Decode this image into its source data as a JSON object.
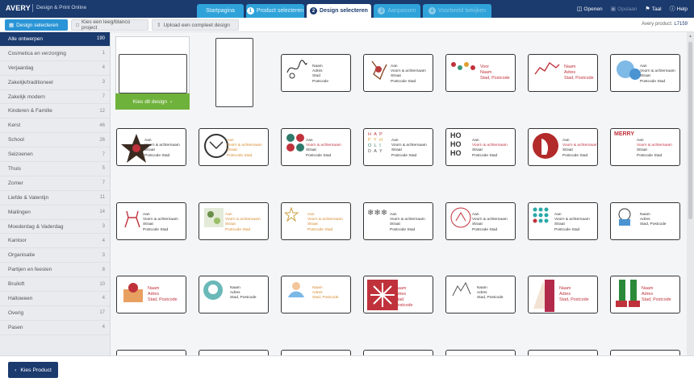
{
  "header": {
    "logo": "AVERY",
    "subtitle": "Design & Print Online",
    "steps": [
      {
        "num": "",
        "label": "Startpagina"
      },
      {
        "num": "1",
        "label": "Product selecteren"
      },
      {
        "num": "2",
        "label": "Design selecteren"
      },
      {
        "num": "3",
        "label": "Aanpassen"
      },
      {
        "num": "4",
        "label": "Voorbeeld bekijken"
      }
    ],
    "links": [
      "Openen",
      "Opslaan",
      "Taal",
      "Help"
    ]
  },
  "subbar": {
    "buttons": [
      "Design selecteren",
      "Kies een leeg/blanco project",
      "Upload een compleet design"
    ],
    "avery_product_label": "Avery product:",
    "avery_product_code": "L7159"
  },
  "sidebar": {
    "categories": [
      {
        "label": "Alle ontwerpen",
        "count": "190"
      },
      {
        "label": "Cosmetica en verzorging",
        "count": "1"
      },
      {
        "label": "Verjaardag",
        "count": "4"
      },
      {
        "label": "Zakelijk/traditioneel",
        "count": "3"
      },
      {
        "label": "Zakelijk modern",
        "count": "7"
      },
      {
        "label": "Kinderen & Familie",
        "count": "12"
      },
      {
        "label": "Kerst",
        "count": "46"
      },
      {
        "label": "School",
        "count": "26"
      },
      {
        "label": "Seizoenen",
        "count": "7"
      },
      {
        "label": "Thuis",
        "count": "5"
      },
      {
        "label": "Zomer",
        "count": "7"
      },
      {
        "label": "Liefde & Valentijn",
        "count": "11"
      },
      {
        "label": "Mailingen",
        "count": "14"
      },
      {
        "label": "Moederdag & Vaderdag",
        "count": "3"
      },
      {
        "label": "Kantoor",
        "count": "4"
      },
      {
        "label": "Organisatie",
        "count": "3"
      },
      {
        "label": "Partijen en feesten",
        "count": "8"
      },
      {
        "label": "Bruiloft",
        "count": "10"
      },
      {
        "label": "Halloween",
        "count": "4"
      },
      {
        "label": "Overig",
        "count": "17"
      },
      {
        "label": "Pasen",
        "count": "4"
      }
    ]
  },
  "grid": {
    "choose_button": "Kies dit design",
    "labels": [
      [
        "Naam",
        "Adres",
        "Stad",
        "Postcode"
      ],
      [
        "Aan",
        "Voorn & achternaam",
        "Straat",
        "Postcode Stad"
      ],
      [
        "Voor",
        "Naam",
        "Stad, Postcode"
      ],
      [
        "Naam",
        "Adres",
        "Stad, Postcode"
      ],
      [
        "Aan",
        "Voorn & achternaam",
        "Straat",
        "Postcode Stad"
      ],
      [
        "Aan",
        "Voorn & achternaam",
        "Straat",
        "Postcode Stad"
      ],
      [
        "Aan",
        "Voorn & achternaam",
        "Straat",
        "Postcode Stad"
      ],
      [
        "Aan",
        "Voorn & achternaam",
        "Straat",
        "Postcode Stad"
      ],
      [
        "Aan",
        "Voorn & achternaam",
        "Straat",
        "Postcode Stad"
      ],
      [
        "Aan",
        "Voorn & achternaam",
        "Straat",
        "Postcode Stad"
      ],
      [
        "Aan",
        "Voorn & achternaam",
        "Straat",
        "Postcode Stad"
      ],
      [
        "Aan",
        "Voorn & achternaam",
        "Straat",
        "Postcode Stad"
      ],
      [
        "Aan",
        "Voorn & achternaam",
        "Straat",
        "Postcode Stad"
      ],
      [
        "Aan",
        "Voorn & achternaam",
        "Straat",
        "Postcode Stad"
      ],
      [
        "Aan",
        "Voorn & achternaam",
        "Straat",
        "Postcode Stad"
      ],
      [
        "Aan",
        "Voorn & achternaam",
        "Straat",
        "Postcode Stad"
      ],
      [
        "Aan",
        "Voorn & achternaam",
        "Straat",
        "Postcode Stad"
      ],
      [
        "Aan",
        "Voorn & achternaam",
        "Straat",
        "Postcode Stad"
      ],
      [
        "Aan",
        "Voorn & achternaam",
        "Straat",
        "Postcode Stad"
      ],
      [
        "Naam",
        "Adres",
        "Stad, Postcode"
      ],
      [
        "Naam",
        "Adres",
        "Stad, Postcode"
      ],
      [
        "Naam",
        "Adres",
        "Stad, Postcode"
      ],
      [
        "Naam",
        "Adres",
        "Stad, Postcode"
      ],
      [
        "Naam",
        "Adres",
        "Stad",
        "Postcode"
      ],
      [
        "Naam",
        "Adres",
        "Stad, Postcode"
      ],
      [
        "Naam",
        "Adres",
        "Stad, Postcode"
      ],
      [
        "Naam",
        "Adres",
        "Stad, Postcode"
      ]
    ],
    "row2_text": [
      "H A P",
      "P Y H",
      "O L I",
      "D A Y"
    ],
    "row2_hoho": [
      "HO",
      "HO",
      "HO"
    ],
    "merry": "MERRY"
  },
  "footer": {
    "back_label": "Kies Product"
  }
}
